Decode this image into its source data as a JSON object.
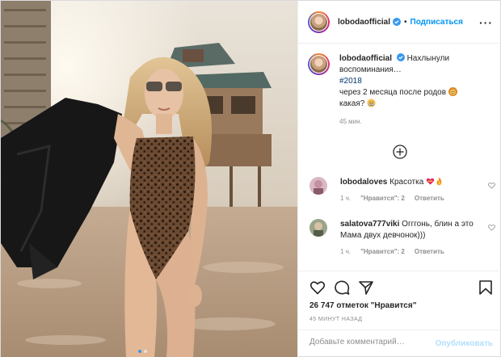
{
  "post": {
    "author": {
      "username": "lobodaofficial",
      "verified": true
    },
    "header": {
      "separator": "•",
      "follow_label": "Подписаться",
      "more_label": "···"
    },
    "caption": {
      "username": "lobodaofficial",
      "text_line1": "Нахлынули воспоминания…",
      "hashtag": "#2018",
      "text_line2": "через 2 месяца после родов",
      "text_line3": "какая?",
      "time": "45 мин.",
      "emoji": [
        "lion-face-emoji",
        "grimacing-face-emoji"
      ]
    },
    "comments": [
      {
        "username": "lobodaloves",
        "text": "Красотка",
        "emoji": [
          "heart-with-ribbon-emoji",
          "fire-emoji"
        ],
        "age": "1 ч.",
        "likes_label": "\"Нравится\": 2",
        "reply_label": "Ответить"
      },
      {
        "username": "salatova777viki",
        "text": "Огггонь, блин а это Мама двух девчонок)))",
        "age": "1 ч.",
        "likes_label": "\"Нравится\": 2",
        "reply_label": "Ответить"
      }
    ],
    "likes_text": "26 747 отметок \"Нравится\"",
    "posted_ago": "45 МИНУТ НАЗАД",
    "comment_input": {
      "placeholder": "Добавьте комментарий…"
    },
    "publish_label": "Опубликовать",
    "carousel": {
      "slides": 2,
      "active": 0
    },
    "icons": [
      "heart-icon",
      "comment-icon",
      "share-icon",
      "bookmark-icon",
      "add-icon",
      "more-options-icon",
      "verified-badge-icon"
    ],
    "colors": {
      "accent": "#0095f6",
      "publish_disabled": "#b2dffc",
      "secondary_text": "#8e8e8e",
      "border": "#dbdbdb",
      "verified": "#3897f0"
    }
  }
}
